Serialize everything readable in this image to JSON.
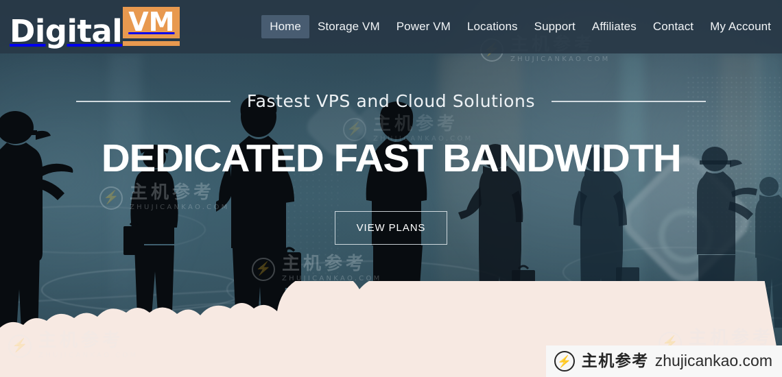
{
  "brand": {
    "word": "Digital",
    "badge": "VM",
    "accent_color": "#e8994f",
    "header_bg": "#283846"
  },
  "nav": {
    "items": [
      {
        "label": "Home",
        "active": true
      },
      {
        "label": "Storage VM",
        "active": false
      },
      {
        "label": "Power VM",
        "active": false
      },
      {
        "label": "Locations",
        "active": false
      },
      {
        "label": "Support",
        "active": false
      },
      {
        "label": "Affiliates",
        "active": false
      },
      {
        "label": "Contact",
        "active": false
      },
      {
        "label": "My Account",
        "active": false
      }
    ]
  },
  "hero": {
    "subtitle": "Fastest VPS and Cloud Solutions",
    "title": "DEDICATED FAST BANDWIDTH",
    "cta_label": "VIEW PLANS"
  },
  "watermarks": {
    "cn": "主机参考",
    "en_caps": "ZHUJICANKAO.COM",
    "domain": "zhujicankao.com",
    "icon": "lightning-circle-icon",
    "badge_bg": "#f7f7f7"
  },
  "colors": {
    "cloud": "#f7e9e2",
    "hero_text": "#ffffff",
    "nav_text": "#f2f5f7",
    "photo_base": "#3e5c69"
  }
}
